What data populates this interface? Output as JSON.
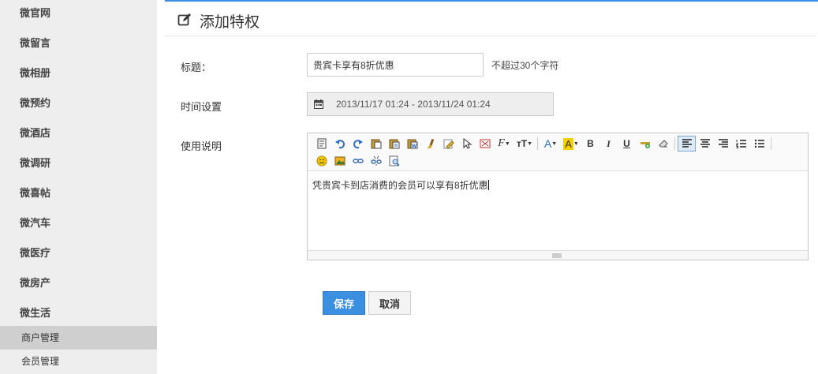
{
  "sidebar": {
    "items": [
      {
        "label": "微官网"
      },
      {
        "label": "微留言"
      },
      {
        "label": "微相册"
      },
      {
        "label": "微预约"
      },
      {
        "label": "微酒店"
      },
      {
        "label": "微调研"
      },
      {
        "label": "微喜帖"
      },
      {
        "label": "微汽车"
      },
      {
        "label": "微医疗"
      },
      {
        "label": "微房产"
      },
      {
        "label": "微生活"
      }
    ],
    "sub_items": [
      {
        "label": "商户管理",
        "active": true
      },
      {
        "label": "会员管理",
        "active": false
      }
    ]
  },
  "header": {
    "title": "添加特权",
    "icon": "edit-icon"
  },
  "form": {
    "title_label": "标题：",
    "title_value": "贵宾卡享有8折优惠",
    "title_hint": "不超过30个字符",
    "time_label": "时间设置",
    "time_value": "2013/11/17 01:24 - 2013/11/24 01:24",
    "desc_label": "使用说明",
    "desc_value": "凭贵宾卡到店消费的会员可以享有8折优惠"
  },
  "toolbar": {
    "font_label": "F",
    "size_label": "тT",
    "forecolor_label": "A",
    "bgcolor_label": "A",
    "bold_label": "B",
    "italic_label": "I",
    "underline_label": "U"
  },
  "actions": {
    "save_label": "保存",
    "cancel_label": "取消"
  },
  "colors": {
    "accent": "#3b8fe0",
    "sidebar_bg": "#eeeeee",
    "active_bg": "#cfcfcf"
  }
}
